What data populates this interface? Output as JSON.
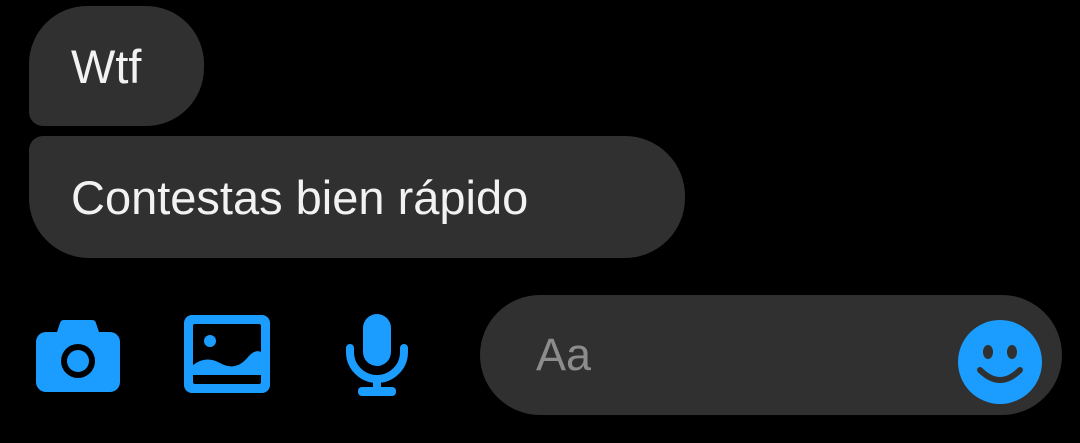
{
  "messages": [
    {
      "text": "Wtf"
    },
    {
      "text": "Contestas bien rápido"
    }
  ],
  "toolbar": {
    "icons": [
      "camera-icon",
      "gallery-icon",
      "microphone-icon"
    ],
    "accent_color": "#1b9cff"
  },
  "composer": {
    "placeholder": "Aa",
    "emoji_icon": "smiley-emoji-icon"
  },
  "colors": {
    "background": "#000000",
    "bubble": "#303030",
    "bubble_text": "#f2f2f2",
    "placeholder_text": "#8c8c8c"
  }
}
